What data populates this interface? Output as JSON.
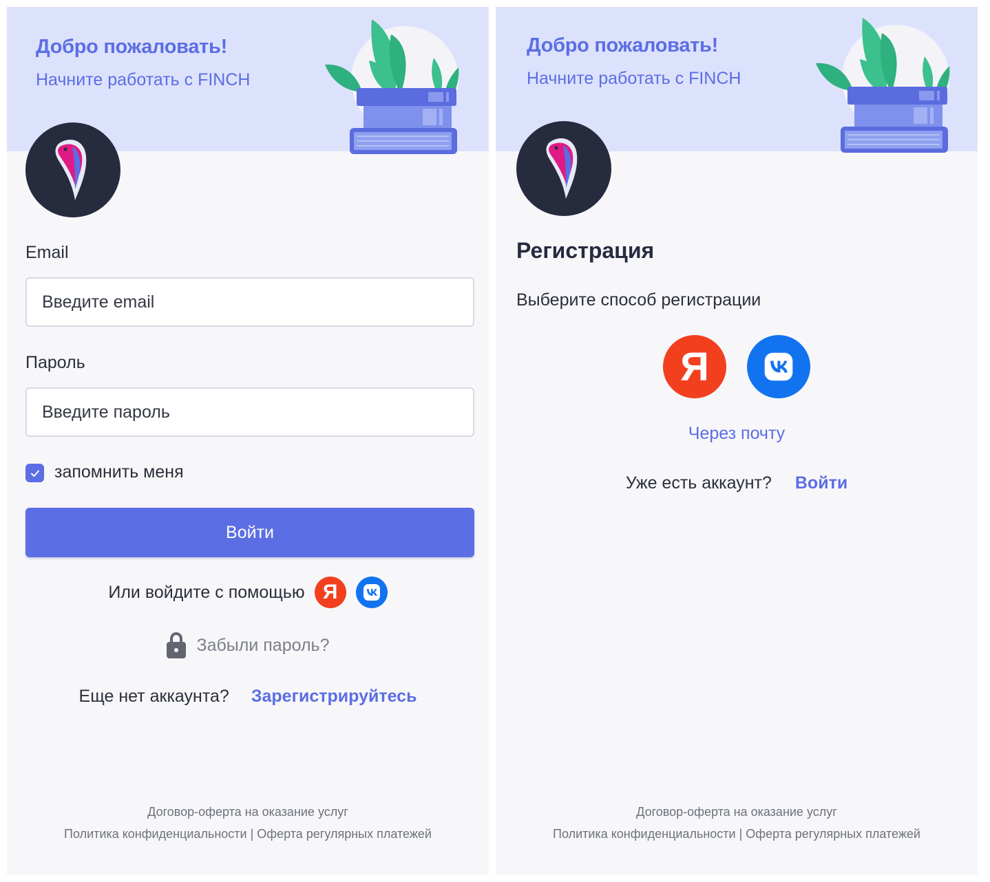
{
  "colors": {
    "accent": "#5b6ee3",
    "hero_bg": "#dde2fc",
    "page_bg": "#f7f7fa",
    "logo_bg": "#262b3e",
    "yandex": "#f2401f",
    "vk": "#1273f0"
  },
  "icons": [
    "finch-logo-icon",
    "yandex-icon",
    "vk-icon",
    "lock-icon",
    "checkmark-icon",
    "books-plant-illustration"
  ],
  "login": {
    "header": {
      "title": "Добро пожаловать!",
      "subtitle": "Начните работать с FINCH"
    },
    "email": {
      "label": "Email",
      "placeholder": "Введите email",
      "value": ""
    },
    "password": {
      "label": "Пароль",
      "placeholder": "Введите пароль",
      "value": ""
    },
    "remember": {
      "label": "запомнить меня",
      "checked": true
    },
    "submit_label": "Войти",
    "social_text": "Или войдите с помощью",
    "yandex_glyph": "Я",
    "forgot_label": "Забыли пароль?",
    "no_account_text": "Еще нет аккаунта?",
    "register_link": "Зарегистрируйтесь",
    "footer": {
      "offer": "Договор-оферта на оказание услуг",
      "privacy": "Политика конфиденциальности",
      "separator": "|",
      "recurring": "Оферта регулярных платежей"
    }
  },
  "register": {
    "header": {
      "title": "Добро пожаловать!",
      "subtitle": "Начните работать с FINCH"
    },
    "title": "Регистрация",
    "subtitle": "Выберите способ регистрации",
    "yandex_glyph": "Я",
    "via_email": "Через почту",
    "have_account_text": "Уже есть аккаунт?",
    "login_link": "Войти",
    "footer": {
      "offer": "Договор-оферта на оказание услуг",
      "privacy": "Политика конфиденциальности",
      "separator": "|",
      "recurring": "Оферта регулярных платежей"
    }
  }
}
